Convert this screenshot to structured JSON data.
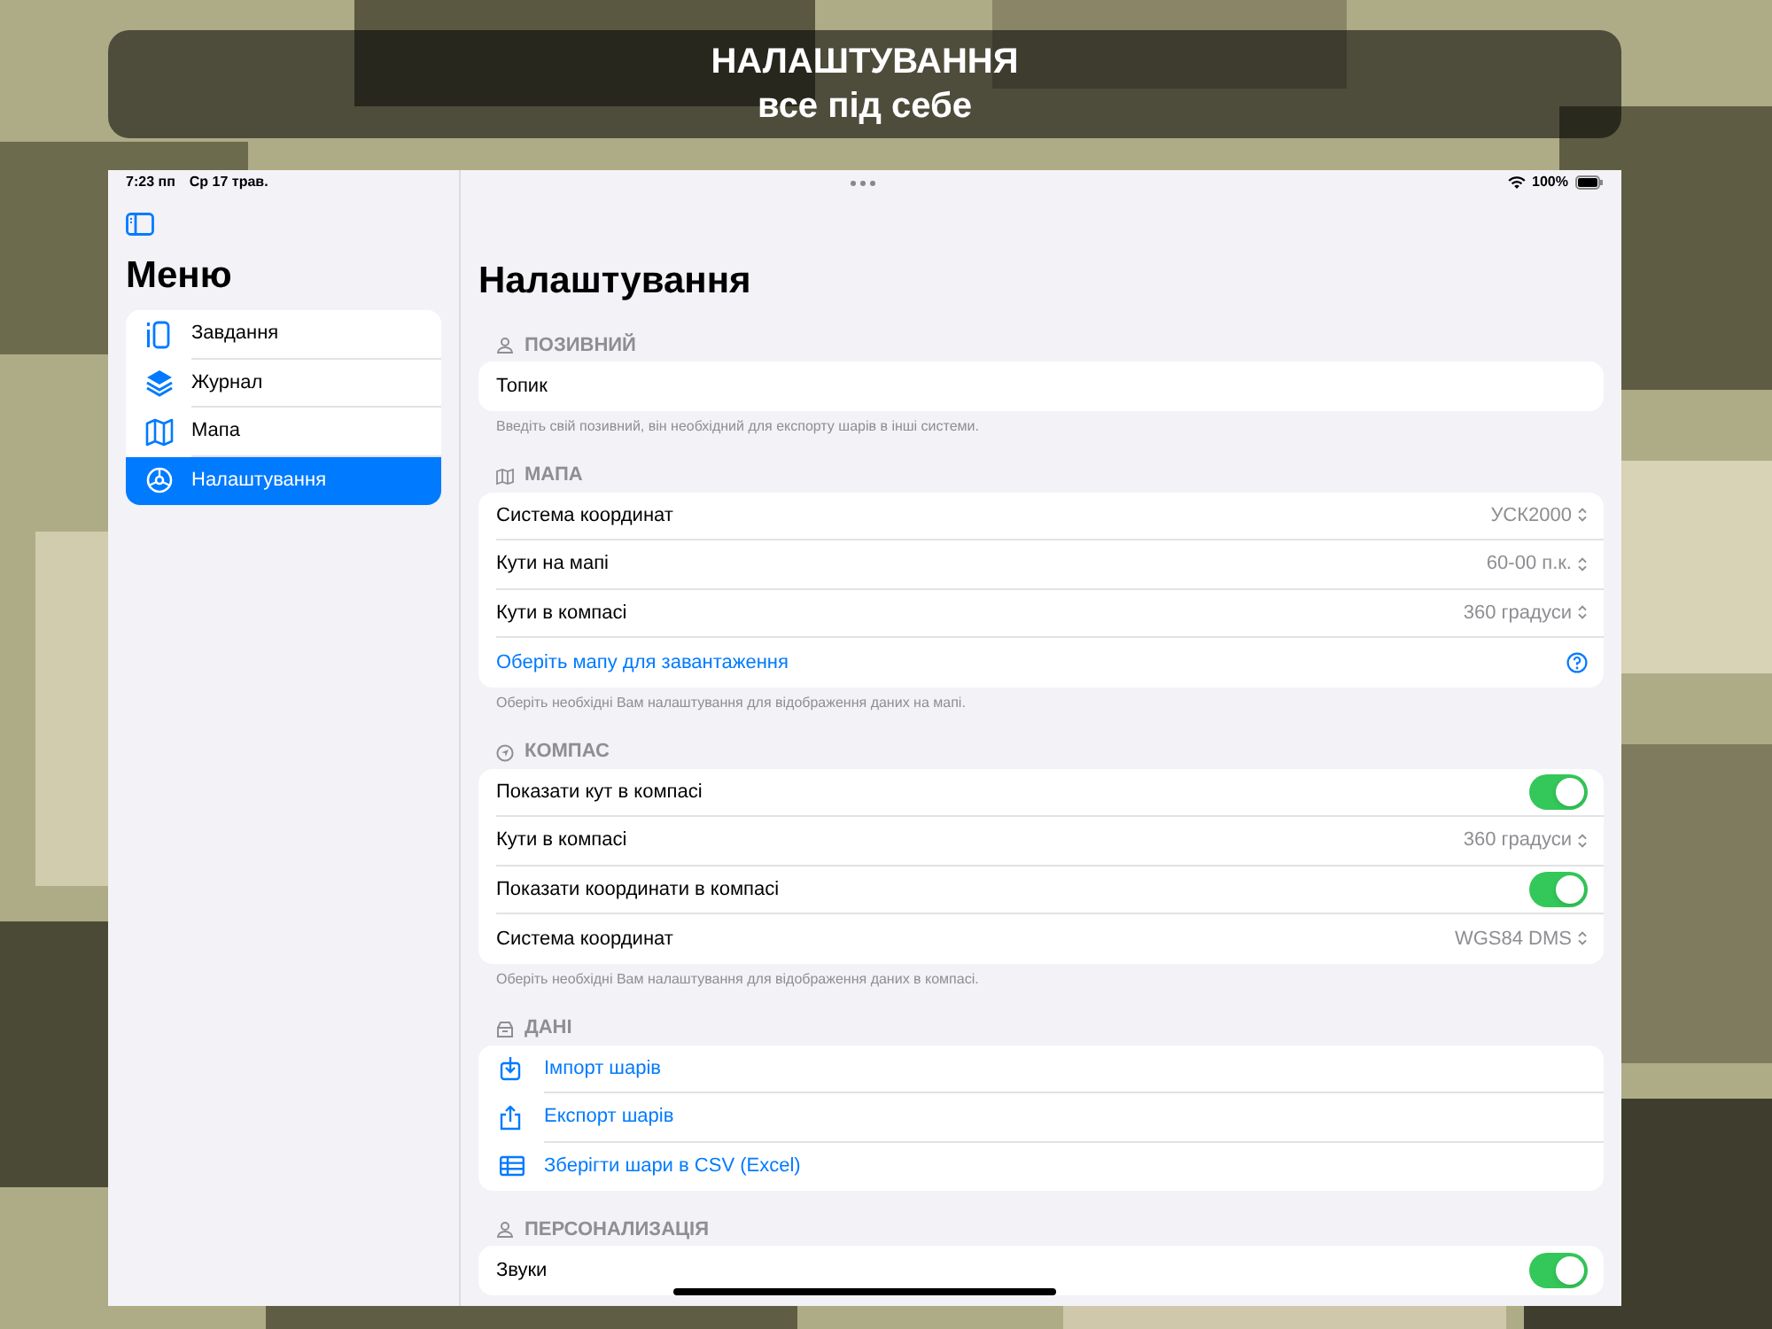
{
  "banner": {
    "title": "НАЛАШТУВАННЯ",
    "subtitle": "все під себе"
  },
  "status_bar": {
    "time": "7:23 пп",
    "date": "Ср 17 трав.",
    "battery": "100%"
  },
  "sidebar": {
    "title": "Меню",
    "items": [
      {
        "label": "Завдання",
        "selected": false
      },
      {
        "label": "Журнал",
        "selected": false
      },
      {
        "label": "Мапа",
        "selected": false
      },
      {
        "label": "Налаштування",
        "selected": true
      }
    ]
  },
  "detail": {
    "title": "Налаштування",
    "sections": [
      {
        "header": "ПОЗИВНИЙ",
        "rows": [
          {
            "kind": "text",
            "label": "Топик"
          }
        ],
        "footer": "Введіть свій позивний, він необхідний для експорту шарів в інші системи."
      },
      {
        "header": "МАПА",
        "rows": [
          {
            "kind": "picker",
            "label": "Система координат",
            "value": "УСК2000"
          },
          {
            "kind": "picker",
            "label": "Кути на мапі",
            "value": "60-00 п.к."
          },
          {
            "kind": "picker",
            "label": "Кути в компасі",
            "value": "360 градуси"
          },
          {
            "kind": "link",
            "label": "Оберіть мапу для завантаження"
          }
        ],
        "footer": "Оберіть необхідні Вам налаштування для відображення даних на мапі."
      },
      {
        "header": "КОМПАС",
        "rows": [
          {
            "kind": "toggle",
            "label": "Показати кут в компасі",
            "on": true
          },
          {
            "kind": "picker",
            "label": "Кути в компасі",
            "value": "360 градуси"
          },
          {
            "kind": "toggle",
            "label": "Показати координати в компасі",
            "on": true
          },
          {
            "kind": "picker",
            "label": "Система координат",
            "value": "WGS84 DMS"
          }
        ],
        "footer": "Оберіть необхідні Вам налаштування для відображення даних в компасі."
      },
      {
        "header": "ДАНІ",
        "rows": [
          {
            "kind": "action",
            "label": "Імпорт шарів"
          },
          {
            "kind": "action",
            "label": "Експорт шарів"
          },
          {
            "kind": "action",
            "label": "Зберігти шари в CSV (Excel)"
          }
        ]
      },
      {
        "header": "ПЕРСОНАЛИЗАЦІЯ",
        "rows": [
          {
            "kind": "toggle",
            "label": "Звуки",
            "on": true
          }
        ]
      }
    ]
  }
}
